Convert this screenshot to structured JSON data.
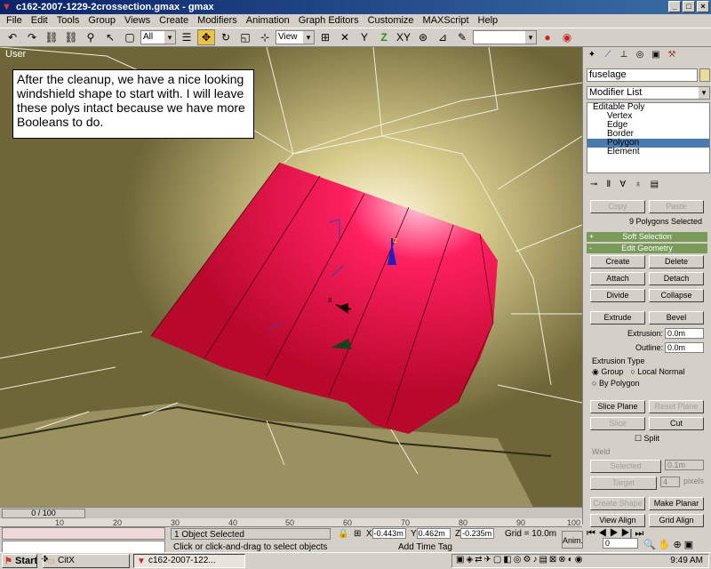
{
  "window": {
    "title": "c162-2007-1229-2crossection.gmax - gmax",
    "minimize": "_",
    "maximize": "□",
    "close": "×"
  },
  "menu": [
    "File",
    "Edit",
    "Tools",
    "Group",
    "Views",
    "Create",
    "Modifiers",
    "Animation",
    "Graph Editors",
    "Customize",
    "MAXScript",
    "Help"
  ],
  "toolbar": {
    "selection_filter": "All",
    "ref_coord": "View"
  },
  "viewport": {
    "label": "User",
    "callout": "After the cleanup, we have a nice looking windshield shape to start with. I will leave these polys intact because we have more Booleans to do.",
    "gizmo_x": "x",
    "gizmo_z": "z"
  },
  "command_panel": {
    "object_name": "fuselage",
    "object_color": "#eedd99",
    "modifier_list": "Modifier List",
    "stack": [
      "Editable Poly",
      "Vertex",
      "Edge",
      "Border",
      "Polygon",
      "Element"
    ],
    "selected_stack_index": 4,
    "copy_label": "Copy",
    "paste_label": "Paste",
    "selection_status": "9 Polygons Selected",
    "soft_selection": {
      "sign": "+",
      "title": "Soft Selection"
    },
    "edit_geometry": {
      "sign": "-",
      "title": "Edit Geometry"
    },
    "buttons": {
      "create": "Create",
      "delete": "Delete",
      "attach": "Attach",
      "detach": "Detach",
      "divide": "Divide",
      "collapse": "Collapse",
      "extrude": "Extrude",
      "bevel": "Bevel",
      "slice_plane": "Slice Plane",
      "reset_plane": "Reset Plane",
      "slice": "Slice",
      "cut": "Cut",
      "selected": "Selected",
      "target": "Target",
      "create_shape": "Create Shape",
      "make_planar": "Make Planar",
      "view_align": "View Align",
      "grid_align": "Grid Align"
    },
    "extrusion_label": "Extrusion:",
    "extrusion_value": "0.0m",
    "outline_label": "Outline:",
    "outline_value": "0.0m",
    "extrusion_type_label": "Extrusion Type",
    "group_label": "Group",
    "local_normal_label": "Local Normal",
    "by_polygon_label": "By Polygon",
    "split_label": "Split",
    "weld_label": "Weld",
    "weld_selected_value": "0.1m",
    "target_value": "4",
    "pixels_label": "pixels"
  },
  "timeline": {
    "slider": "0 / 100",
    "ticks": [
      "10",
      "20",
      "30",
      "40",
      "50",
      "60",
      "70",
      "80",
      "90",
      "100"
    ]
  },
  "status": {
    "objects_selected": "1 Object Selected",
    "prompt": "Click or click-and-drag to select objects",
    "x_label": "X",
    "x_value": "-0.443m",
    "y_label": "Y",
    "y_value": "0.462m",
    "z_label": "Z",
    "z_value": "-0.235m",
    "grid": "Grid = 10.0m",
    "add_time_tag": "Add Time Tag",
    "anim": "Anim.",
    "frame": "0"
  },
  "taskbar": {
    "start": "Start",
    "tasks": [
      "CitX",
      "c162-2007-122..."
    ],
    "active_task_index": 1,
    "clock": "9:49 AM"
  }
}
